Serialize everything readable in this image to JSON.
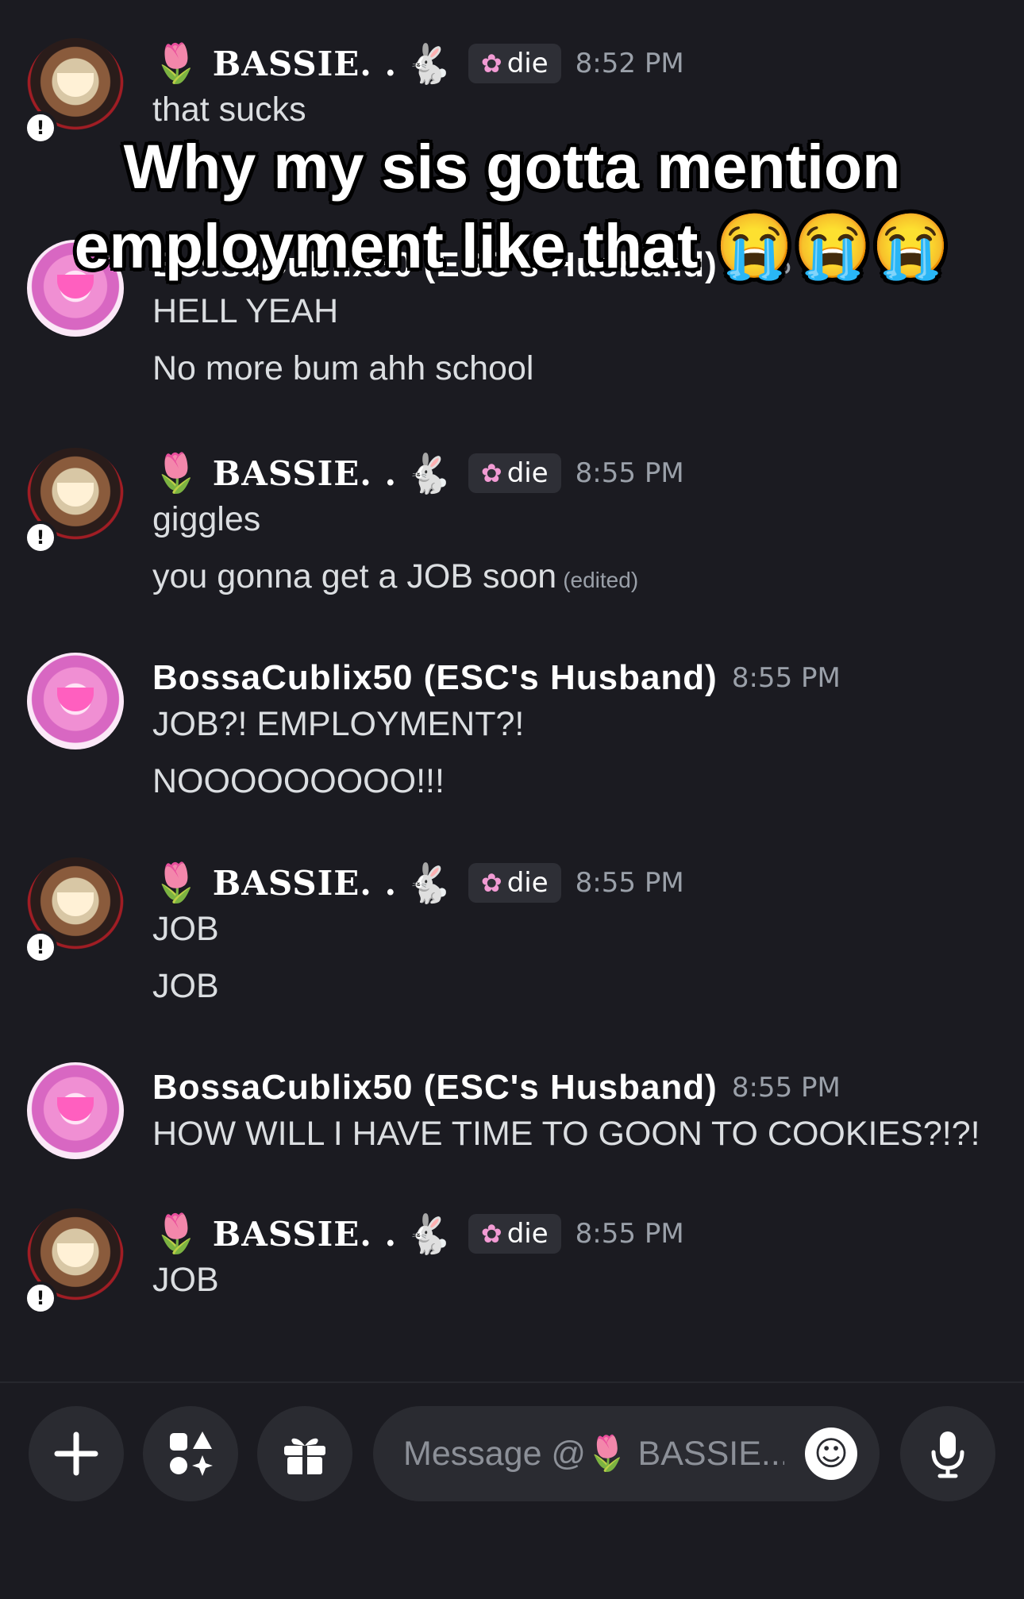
{
  "messages": [
    {
      "author": "BASSIE. .",
      "tulip": "🌷",
      "rabbit": "🐇",
      "role": "die",
      "time": "8:52 PM",
      "lines": [
        "that sucks"
      ]
    },
    {
      "author": "BossaCublix50 (ESC's Husband)",
      "time": "8:55 PM",
      "lines": [
        "HELL YEAH",
        "No more bum ahh school"
      ]
    },
    {
      "author": "BASSIE. .",
      "tulip": "🌷",
      "rabbit": "🐇",
      "role": "die",
      "time": "8:55 PM",
      "lines": [
        "giggles",
        "you gonna get a JOB soon"
      ],
      "edited": "(edited)"
    },
    {
      "author": "BossaCublix50 (ESC's Husband)",
      "time": "8:55 PM",
      "lines": [
        "JOB?! EMPLOYMENT?!",
        "NOOOOOOOOO!!!"
      ]
    },
    {
      "author": "BASSIE. .",
      "tulip": "🌷",
      "rabbit": "🐇",
      "role": "die",
      "time": "8:55 PM",
      "lines": [
        "JOB",
        "JOB"
      ]
    },
    {
      "author": "BossaCublix50 (ESC's Husband)",
      "time": "8:55 PM",
      "lines": [
        "HOW WILL I HAVE TIME TO GOON TO COOKIES?!?!"
      ]
    },
    {
      "author": "BASSIE. .",
      "tulip": "🌷",
      "rabbit": "🐇",
      "role": "die",
      "time": "8:55 PM",
      "lines": [
        "JOB"
      ]
    }
  ],
  "caption": {
    "line1": "Why my sis gotta mention",
    "line2": "employment like that 😭😭😭"
  },
  "composer": {
    "placeholder": "Message @🌷 BASSIE...",
    "icons": [
      "plus-icon",
      "apps-icon",
      "gift-icon",
      "emoji-icon",
      "microphone-icon"
    ]
  },
  "status_badge": "!",
  "colors": {
    "background": "#1b1b21",
    "username": "#ffffff",
    "message_text": "#dbdee1",
    "timestamp": "#9aa0a9",
    "role_tag_bg": "#2e2f36",
    "input_bg": "#2a2b31"
  }
}
